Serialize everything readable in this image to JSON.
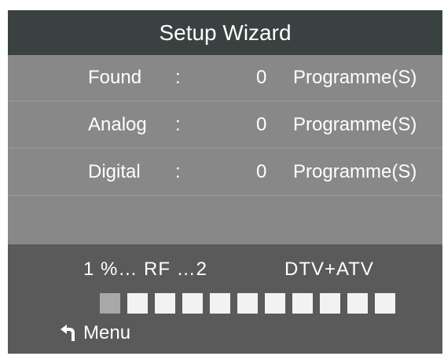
{
  "header": {
    "title": "Setup Wizard"
  },
  "results": [
    {
      "label": "Found",
      "colon": ":",
      "count": "0",
      "unit": "Programme(S)"
    },
    {
      "label": "Analog",
      "colon": ":",
      "count": "0",
      "unit": "Programme(S)"
    },
    {
      "label": "Digital",
      "colon": ":",
      "count": "0",
      "unit": "Programme(S)"
    }
  ],
  "footer": {
    "scan_status": "1  %…  RF  …2",
    "tuner_mode": "DTV+ATV",
    "progress": {
      "total_segments": 11,
      "filled_segments": 1
    },
    "menu_hint_icon": "return-arrow-icon",
    "menu_hint_label": "Menu"
  },
  "colors": {
    "title_bar": "#394241",
    "panel": "#888888",
    "footer": "#5a5a5a",
    "segment_empty": "#f2f2f2",
    "segment_filled": "#a8a8a8"
  }
}
